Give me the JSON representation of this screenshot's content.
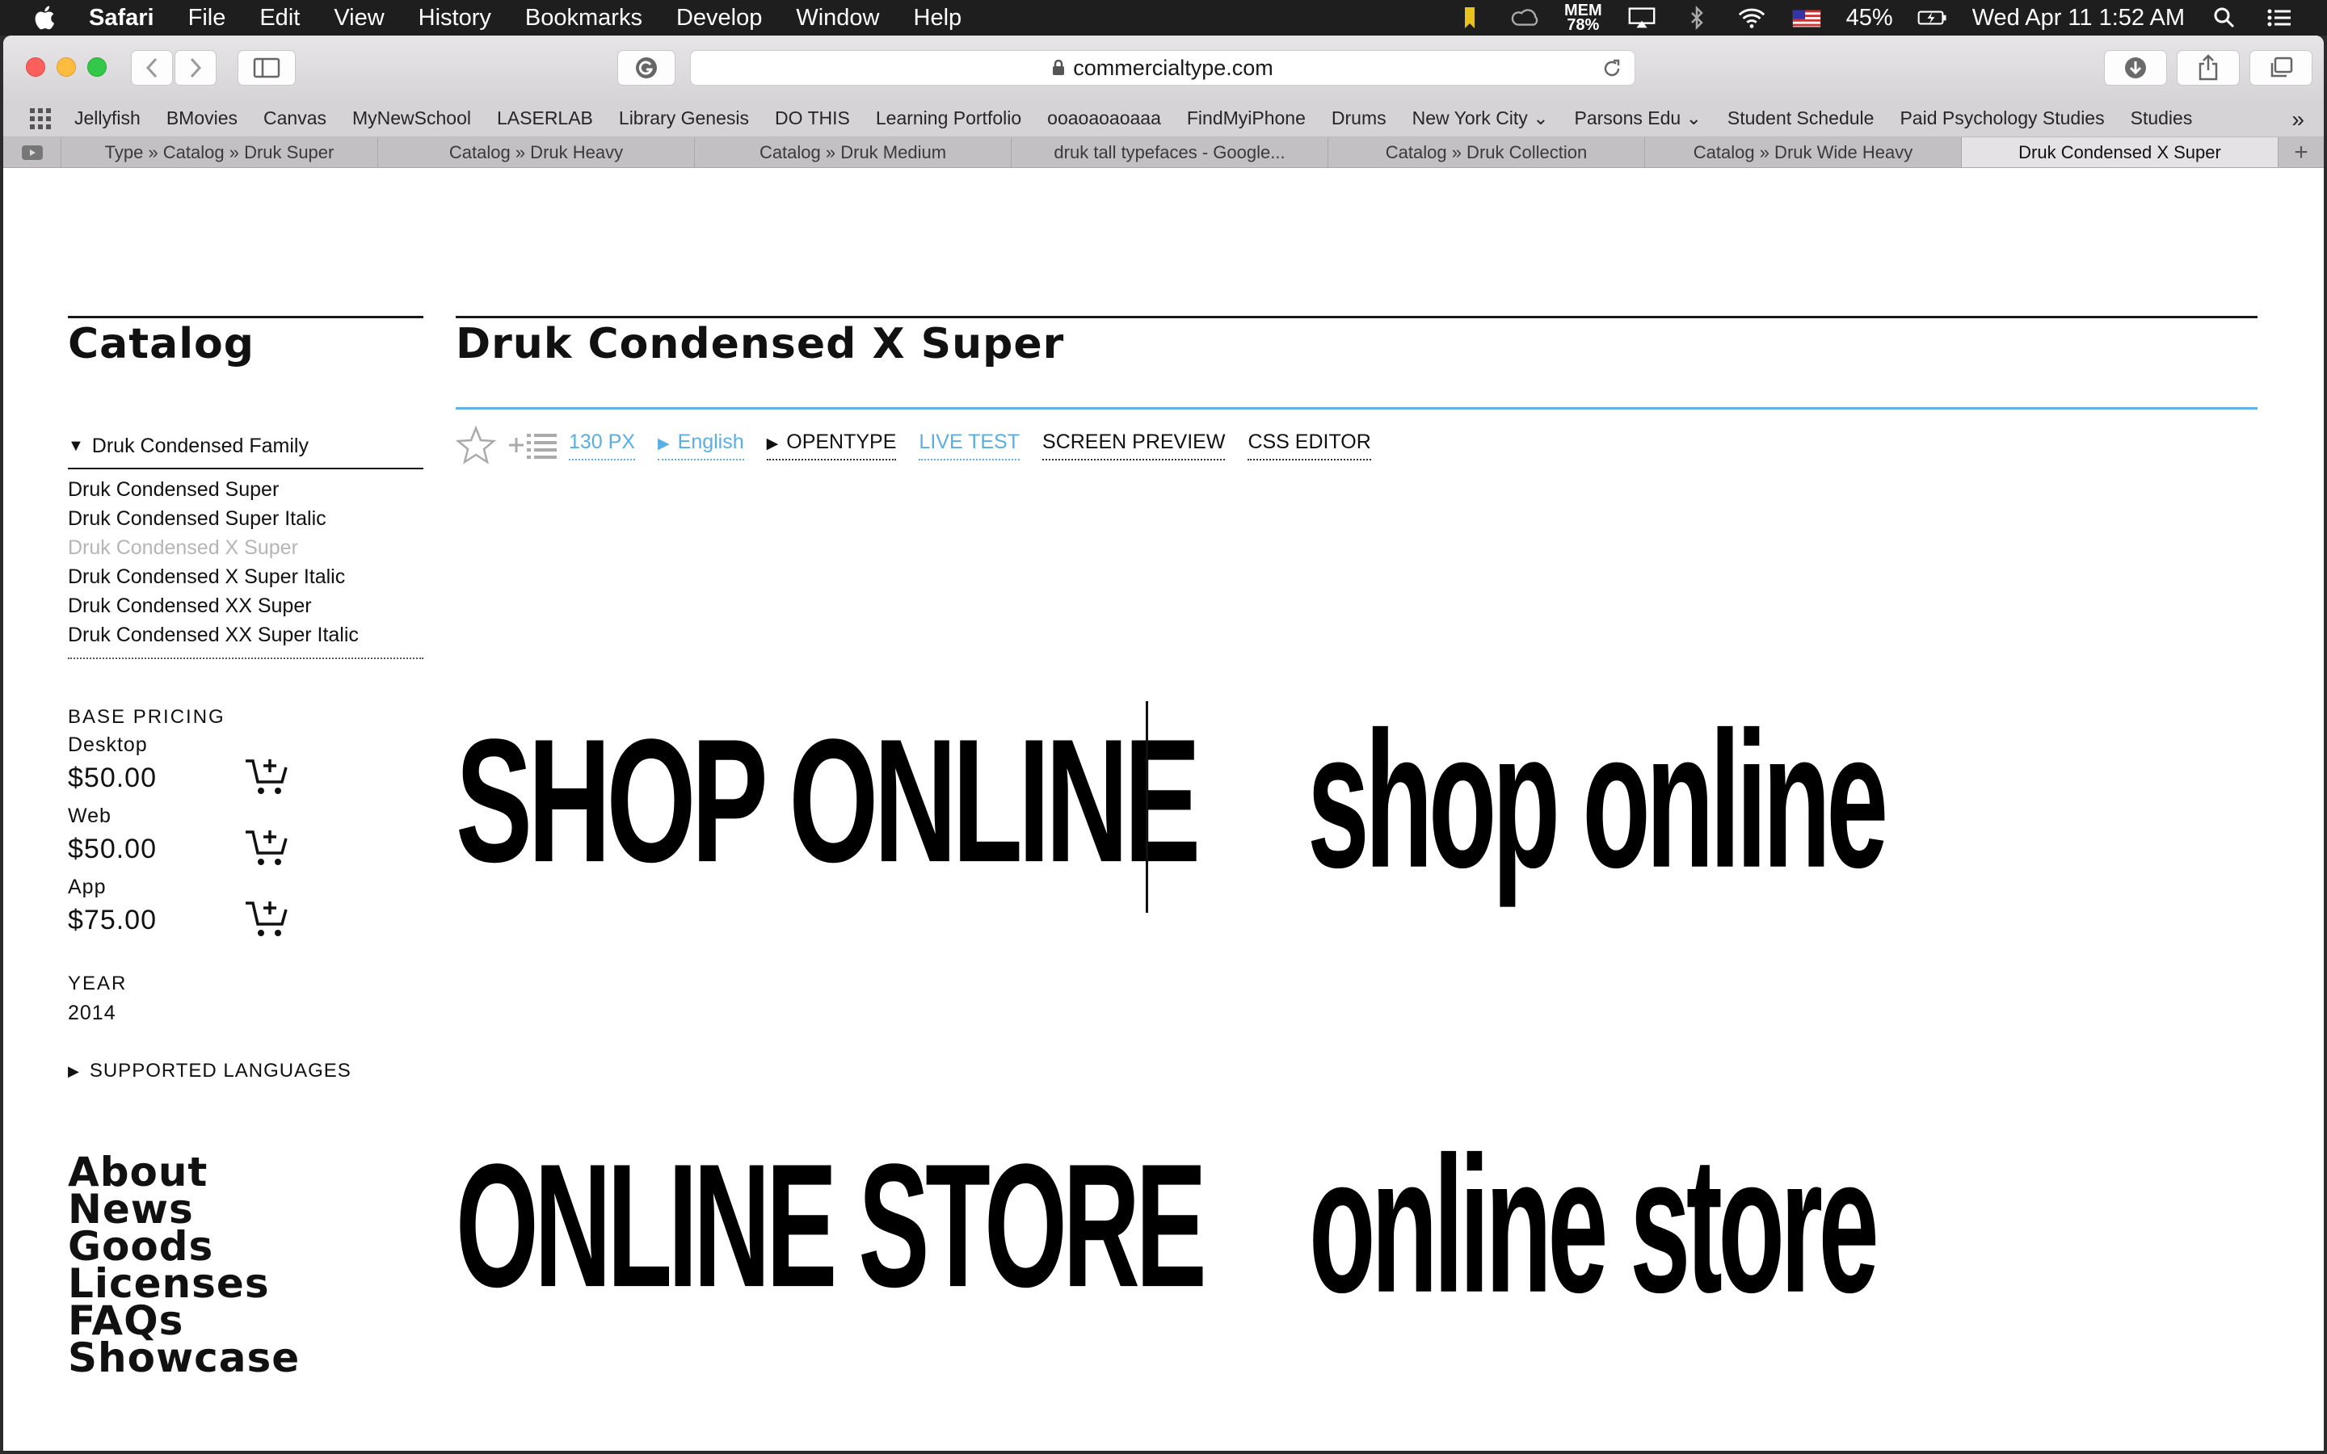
{
  "menubar": {
    "app": "Safari",
    "menus": [
      "File",
      "Edit",
      "View",
      "History",
      "Bookmarks",
      "Develop",
      "Window",
      "Help"
    ],
    "mem_label": "MEM",
    "mem_value": "78%",
    "battery": "45%",
    "datetime": "Wed Apr 11  1:52 AM"
  },
  "browser": {
    "url": "commercialtype.com",
    "bookmarks": [
      "Jellyfish",
      "BMovies",
      "Canvas",
      "MyNewSchool",
      "LASERLAB",
      "Library Genesis",
      "DO THIS",
      "Learning Portfolio",
      "ooaoaoaoaaa",
      "FindMyiPhone",
      "Drums",
      "New York City",
      "Parsons Edu",
      "Student Schedule",
      "Paid Psychology Studies",
      "Studies"
    ],
    "tabs": [
      "Type » Catalog » Druk Super",
      "Catalog » Druk Heavy",
      "Catalog » Druk Medium",
      "druk tall typefaces - Google...",
      "Catalog » Druk Collection",
      "Catalog » Druk Wide Heavy",
      "Druk Condensed X Super"
    ],
    "active_tab_index": 6
  },
  "sidebar": {
    "title": "Catalog",
    "family_label": "Druk Condensed Family",
    "styles": [
      "Druk Condensed Super",
      "Druk Condensed Super Italic",
      "Druk Condensed X Super",
      "Druk Condensed X Super Italic",
      "Druk Condensed XX Super",
      "Druk Condensed XX Super Italic"
    ],
    "current_style_index": 2,
    "base_pricing_label": "BASE PRICING",
    "prices": [
      {
        "label": "Desktop",
        "price": "$50.00"
      },
      {
        "label": "Web",
        "price": "$50.00"
      },
      {
        "label": "App",
        "price": "$75.00"
      }
    ],
    "year_label": "YEAR",
    "year": "2014",
    "supported_languages": "SUPPORTED LANGUAGES",
    "nav": [
      "About",
      "News",
      "Goods",
      "Licenses",
      "FAQs",
      "Showcase"
    ]
  },
  "main": {
    "font_title": "Druk Condensed X Super",
    "controls": {
      "size": "130 PX",
      "language": "English",
      "opentype": "OPENTYPE",
      "live_test": "LIVE TEST",
      "screen_preview": "SCREEN PREVIEW",
      "css_editor": "CSS EDITOR"
    },
    "specimens": [
      "SHOP ONLINE",
      "shop online",
      "ONLINE STORE",
      "online store"
    ]
  },
  "colors": {
    "accent_blue": "#5aaee6",
    "text": "#111111",
    "muted": "#b5b5b5"
  }
}
